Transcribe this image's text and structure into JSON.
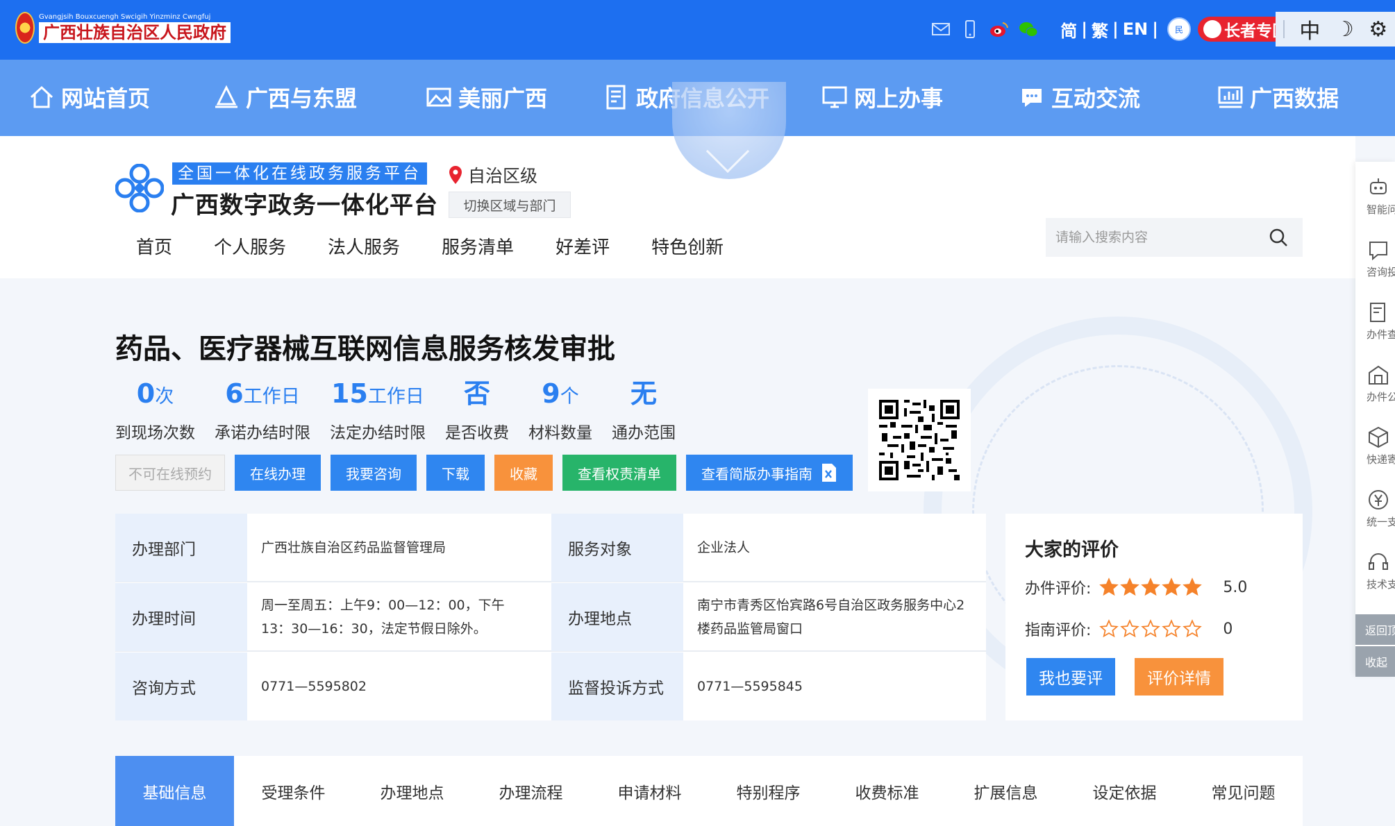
{
  "gov": {
    "logo_small": "Gvangjsih Bouxcuengh Swcigih Yinzminz Cwngfuj",
    "logo_big": "广西壮族自治区人民政府",
    "lang_simplified": "简",
    "lang_traditional": "繁",
    "lang_english": "EN",
    "lang_sep": "|",
    "minzu_label": "民",
    "elder_label": "长者专区",
    "tool_lang": "中",
    "tool_dark": "☽",
    "tool_settings": "⚙"
  },
  "main_nav": [
    {
      "label": "网站首页",
      "icon": "home-icon"
    },
    {
      "label": "广西与东盟",
      "icon": "building-icon"
    },
    {
      "label": "美丽广西",
      "icon": "picture-icon"
    },
    {
      "label": "政府信息公开",
      "icon": "document-icon"
    },
    {
      "label": "网上办事",
      "icon": "monitor-icon"
    },
    {
      "label": "互动交流",
      "icon": "chat-icon"
    },
    {
      "label": "广西数据",
      "icon": "chart-icon"
    }
  ],
  "platform": {
    "subtitle": "全国一体化在线政务服务平台",
    "title": "广西数字政务一体化平台",
    "region": "自治区级",
    "switch_label": "切换区域与部门",
    "search_placeholder": "请输入搜索内容",
    "subnav": [
      "首页",
      "个人服务",
      "法人服务",
      "服务清单",
      "好差评",
      "特色创新"
    ]
  },
  "item": {
    "title": "药品、医疗器械互联网信息服务核发审批",
    "stats": [
      {
        "value": "0",
        "unit": "次",
        "label": "到现场次数"
      },
      {
        "value": "6",
        "unit": "工作日",
        "label": "承诺办结时限"
      },
      {
        "value": "15",
        "unit": "工作日",
        "label": "法定办结时限"
      },
      {
        "value": "否",
        "unit": "",
        "label": "是否收费"
      },
      {
        "value": "9",
        "unit": "个",
        "label": "材料数量"
      },
      {
        "value": "无",
        "unit": "",
        "label": "通办范围"
      }
    ],
    "actions": {
      "no_booking": "不可在线预约",
      "online": "在线办理",
      "consult": "我要咨询",
      "download": "下载",
      "favorite": "收藏",
      "rights_list": "查看权责清单",
      "simple_guide": "查看简版办事指南"
    }
  },
  "info": {
    "dept_label": "办理部门",
    "dept_value": "广西壮族自治区药品监督管理局",
    "target_label": "服务对象",
    "target_value": "企业法人",
    "time_label": "办理时间",
    "time_value": "周一至周五：上午9：00—12：00，下午13：30—16：30，法定节假日除外。",
    "place_label": "办理地点",
    "place_value": "南宁市青秀区怡宾路6号自治区政务服务中心2楼药品监管局窗口",
    "consult_label": "咨询方式",
    "consult_value": "0771—5595802",
    "complaint_label": "监督投诉方式",
    "complaint_value": "0771—5595845"
  },
  "rating": {
    "title": "大家的评价",
    "work_label": "办件评价:",
    "work_score": "5.0",
    "work_stars": 5,
    "guide_label": "指南评价:",
    "guide_score": "0",
    "guide_stars": 0,
    "rate_btn": "我也要评",
    "detail_btn": "评价详情",
    "star_color": "#f5822a"
  },
  "tabs": [
    "基础信息",
    "受理条件",
    "办理地点",
    "办理流程",
    "申请材料",
    "特别程序",
    "收费标准",
    "扩展信息",
    "设定依据",
    "常见问题"
  ],
  "float_bar": {
    "items": [
      "智能问答",
      "咨询投诉",
      "办件查询",
      "办件公示",
      "快递寄送",
      "统一支付",
      "技术支持"
    ],
    "back_top": "返回顶部",
    "collapse": "收起"
  },
  "colors": {
    "gov_blue": "#1d6ff0",
    "nav_blue": "#5c9bf2",
    "accent": "#2a7ff0",
    "orange": "#f8923c",
    "green": "#27b46a"
  }
}
